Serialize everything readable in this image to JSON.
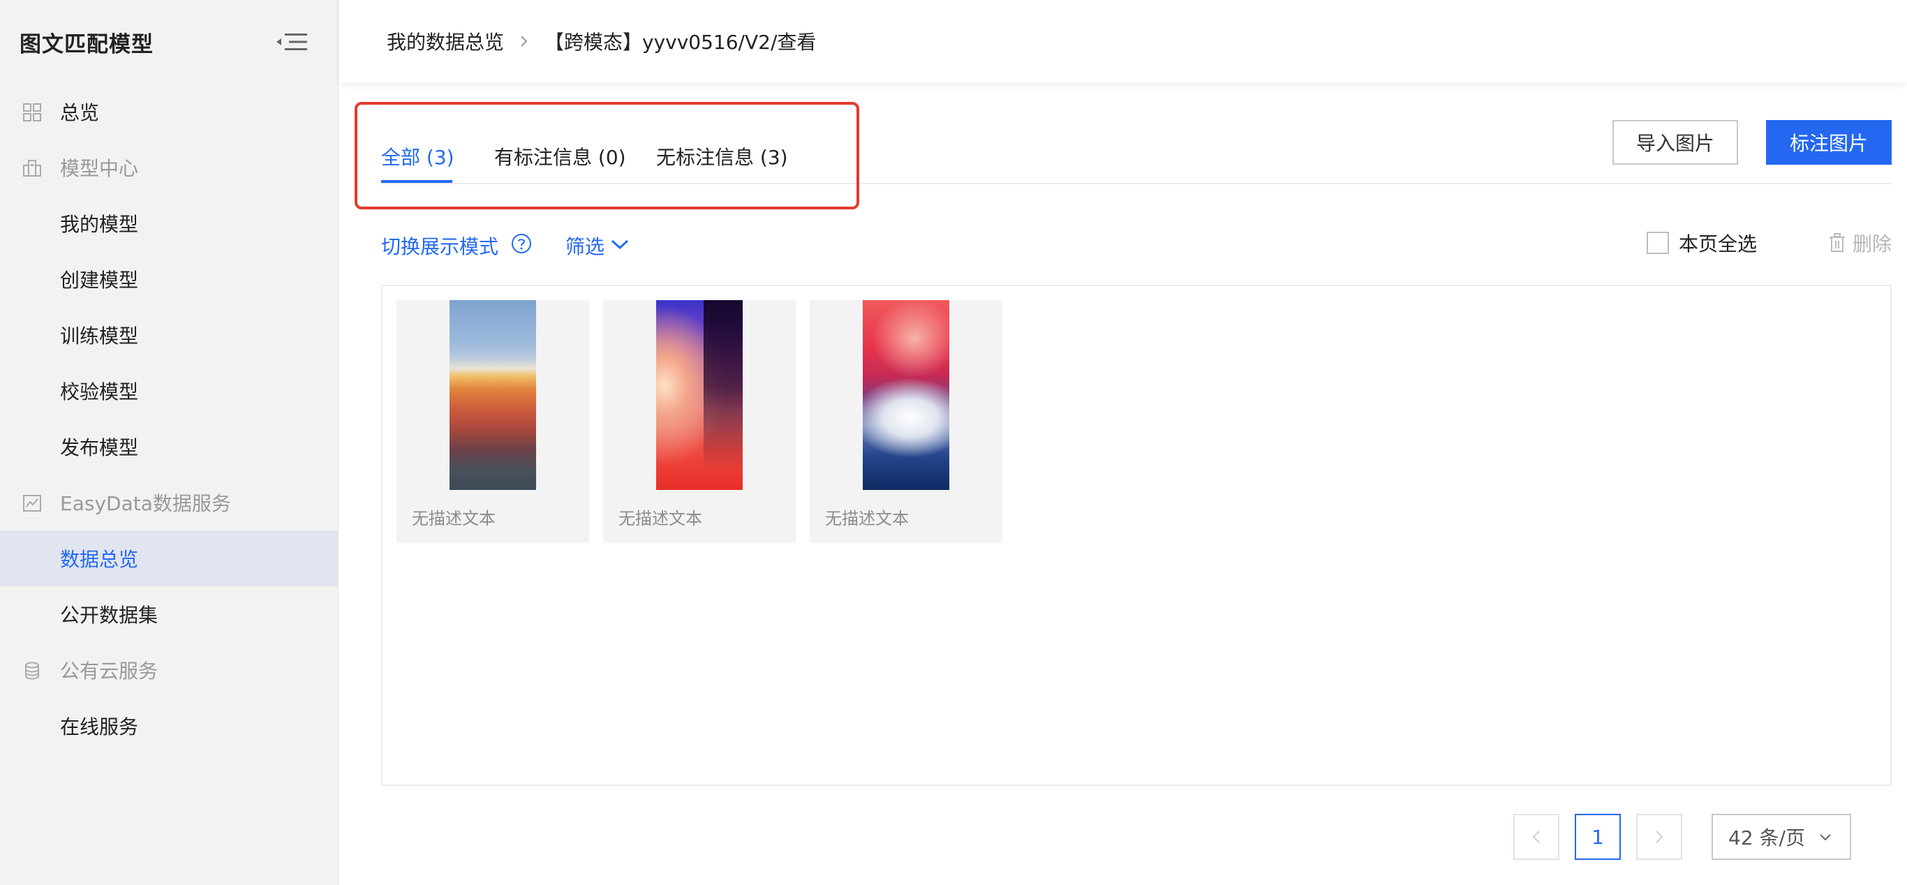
{
  "sidebar": {
    "title": "图文匹配模型",
    "items": [
      {
        "label": "总览",
        "type": "item",
        "icon": "grid-icon"
      },
      {
        "label": "模型中心",
        "type": "group",
        "icon": "buildings-icon"
      },
      {
        "label": "我的模型",
        "type": "child"
      },
      {
        "label": "创建模型",
        "type": "child"
      },
      {
        "label": "训练模型",
        "type": "child"
      },
      {
        "label": "校验模型",
        "type": "child"
      },
      {
        "label": "发布模型",
        "type": "child"
      },
      {
        "label": "EasyData数据服务",
        "type": "group",
        "icon": "chart-icon"
      },
      {
        "label": "数据总览",
        "type": "child",
        "active": true
      },
      {
        "label": "公开数据集",
        "type": "child"
      },
      {
        "label": "公有云服务",
        "type": "group",
        "icon": "database-icon"
      },
      {
        "label": "在线服务",
        "type": "child"
      }
    ]
  },
  "breadcrumb": {
    "parent": "我的数据总览",
    "current": "【跨模态】yyvv0516/V2/查看"
  },
  "tabs": [
    {
      "label": "全部 (3)",
      "active": true
    },
    {
      "label": "有标注信息 (0)",
      "active": false
    },
    {
      "label": "无标注信息 (3)",
      "active": false
    }
  ],
  "actions": {
    "import_label": "导入图片",
    "annotate_label": "标注图片"
  },
  "toolbar": {
    "mode_label": "切换展示模式",
    "filter_label": "筛选",
    "select_all_label": "本页全选",
    "delete_label": "删除"
  },
  "images": [
    {
      "caption": "无描述文本"
    },
    {
      "caption": "无描述文本"
    },
    {
      "caption": "无描述文本"
    }
  ],
  "pagination": {
    "current_page": "1",
    "page_size": "42 条/页"
  },
  "colors": {
    "accent": "#2468f2",
    "highlight_box": "#e33a2e"
  }
}
